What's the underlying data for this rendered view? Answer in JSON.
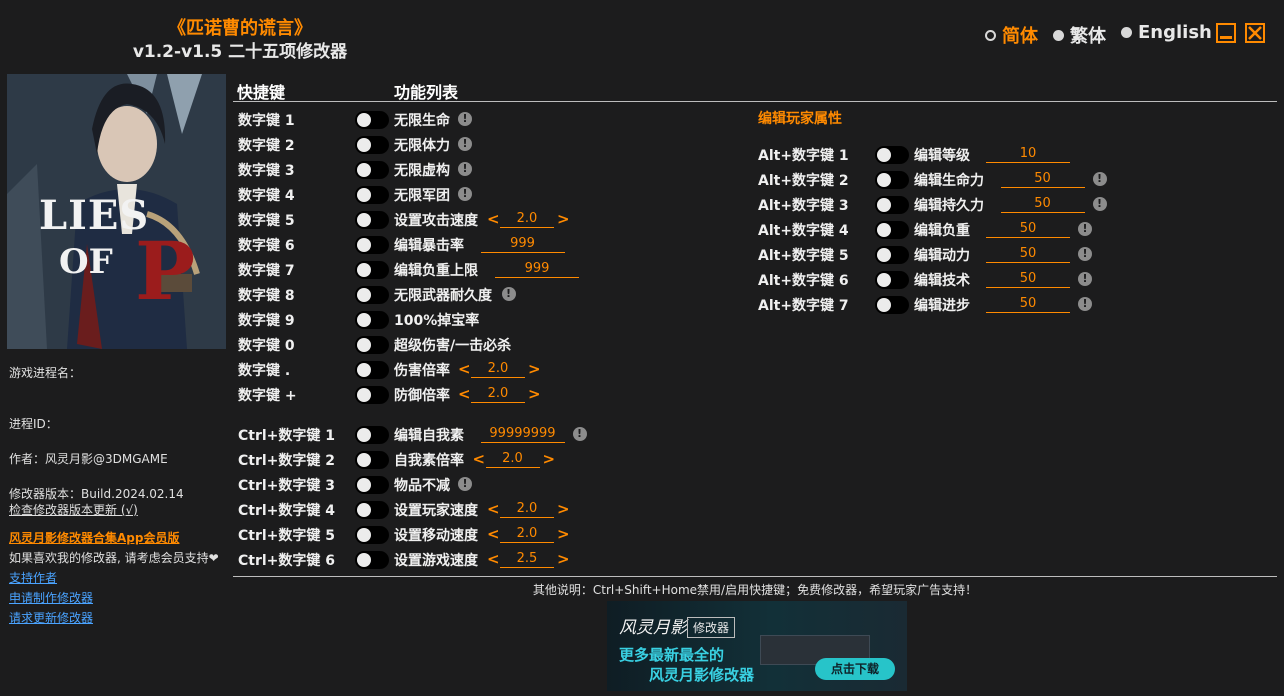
{
  "header": {
    "title_cn": "《匹诺曹的谎言》",
    "title_ver": "v1.2-v1.5 二十五项修改器"
  },
  "languages": [
    {
      "label": "简体",
      "selected": true
    },
    {
      "label": "繁体",
      "selected": false
    },
    {
      "label": "English",
      "selected": false
    }
  ],
  "window": {
    "minimize_icon": "minimize-icon",
    "close_icon": "close-icon",
    "accent": "#ff8a00"
  },
  "cover": {
    "logo_text_1": "LIES",
    "logo_text_2": "OF",
    "logo_text_3": "P"
  },
  "sidebar": {
    "process_name": "游戏进程名：",
    "process_id": "进程ID：",
    "author": "作者：风灵月影@3DMGAME",
    "version": "修改器版本：Build.2024.02.14",
    "check_update": "检查修改器版本更新 (√)",
    "app_link": "风灵月影修改器合集App会员版",
    "support_text": "如果喜欢我的修改器, 请考虑会员支持❤",
    "links": [
      "支持作者",
      "申请制作修改器",
      "请求更新修改器"
    ]
  },
  "columns": {
    "hotkey": "快捷键",
    "features": "功能列表"
  },
  "left_rows": [
    {
      "key": "数字键 1",
      "label": "无限生命",
      "info": true
    },
    {
      "key": "数字键 2",
      "label": "无限体力",
      "info": true
    },
    {
      "key": "数字键 3",
      "label": "无限虚构",
      "info": true
    },
    {
      "key": "数字键 4",
      "label": "无限军团",
      "info": true
    },
    {
      "key": "数字键 5",
      "label": "设置攻击速度",
      "stepper": "2.0"
    },
    {
      "key": "数字键 6",
      "label": "编辑暴击率",
      "value": "999"
    },
    {
      "key": "数字键 7",
      "label": "编辑负重上限",
      "value": "999"
    },
    {
      "key": "数字键 8",
      "label": "无限武器耐久度",
      "info": true
    },
    {
      "key": "数字键 9",
      "label": "100%掉宝率"
    },
    {
      "key": "数字键 0",
      "label": "超级伤害/一击必杀"
    },
    {
      "key": "数字键 .",
      "label": "伤害倍率",
      "stepper": "2.0"
    },
    {
      "key": "数字键 +",
      "label": "防御倍率",
      "stepper": "2.0"
    },
    {
      "key": "Ctrl+数字键 1",
      "label": "编辑自我素",
      "value": "99999999",
      "info": true
    },
    {
      "key": "Ctrl+数字键 2",
      "label": "自我素倍率",
      "stepper": "2.0"
    },
    {
      "key": "Ctrl+数字键 3",
      "label": "物品不减",
      "info": true
    },
    {
      "key": "Ctrl+数字键 4",
      "label": "设置玩家速度",
      "stepper": "2.0"
    },
    {
      "key": "Ctrl+数字键 5",
      "label": "设置移动速度",
      "stepper": "2.0"
    },
    {
      "key": "Ctrl+数字键 6",
      "label": "设置游戏速度",
      "stepper": "2.5"
    }
  ],
  "right_section": {
    "title": "编辑玩家属性",
    "rows": [
      {
        "key": "Alt+数字键 1",
        "label": "编辑等级",
        "value": "10",
        "info": false
      },
      {
        "key": "Alt+数字键 2",
        "label": "编辑生命力",
        "value": "50",
        "info": true
      },
      {
        "key": "Alt+数字键 3",
        "label": "编辑持久力",
        "value": "50",
        "info": true
      },
      {
        "key": "Alt+数字键 4",
        "label": "编辑负重",
        "value": "50",
        "info": true
      },
      {
        "key": "Alt+数字键 5",
        "label": "编辑动力",
        "value": "50",
        "info": true
      },
      {
        "key": "Alt+数字键 6",
        "label": "编辑技术",
        "value": "50",
        "info": true
      },
      {
        "key": "Alt+数字键 7",
        "label": "编辑进步",
        "value": "50",
        "info": true
      }
    ]
  },
  "footer": {
    "note": "其他说明：Ctrl+Shift+Home禁用/启用快捷键；免费修改器，希望玩家广告支持！",
    "banner": {
      "brand": "风灵月影",
      "tag": "修改器",
      "line1": "更多最新最全的",
      "line2": "风灵月影修改器",
      "button": "点击下载"
    }
  },
  "symbols": {
    "info": "!",
    "left_arrow": "<",
    "right_arrow": ">"
  }
}
